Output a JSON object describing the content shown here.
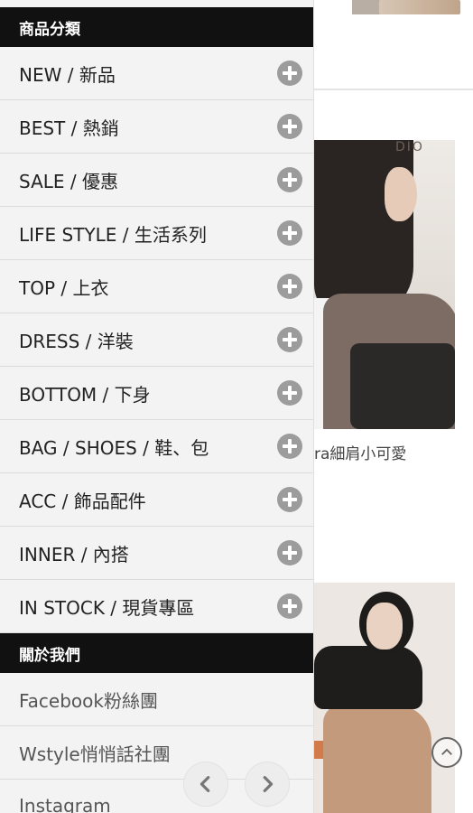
{
  "background": {
    "caption": "ra細肩小可愛",
    "photo_text": "DIO"
  },
  "menu": {
    "categories_header": "商品分類",
    "categories": [
      {
        "label": "NEW / 新品"
      },
      {
        "label": "BEST / 熱銷"
      },
      {
        "label": "SALE / 優惠"
      },
      {
        "label": "LIFE STYLE / 生活系列"
      },
      {
        "label": "TOP / 上衣"
      },
      {
        "label": "DRESS / 洋裝"
      },
      {
        "label": "BOTTOM / 下身"
      },
      {
        "label": "BAG / SHOES / 鞋、包"
      },
      {
        "label": "ACC / 飾品配件"
      },
      {
        "label": "INNER / 內搭"
      },
      {
        "label": "IN STOCK / 現貨專區"
      }
    ],
    "about_header": "關於我們",
    "about_links": [
      {
        "label": "Facebook粉絲團"
      },
      {
        "label": "Wstyle悄悄話社團"
      },
      {
        "label": "Instagram"
      }
    ]
  },
  "icons": {
    "expand": "plus-circle-icon",
    "prev": "chevron-left-icon",
    "next": "chevron-right-icon",
    "scroll_top": "chevron-up-icon"
  }
}
